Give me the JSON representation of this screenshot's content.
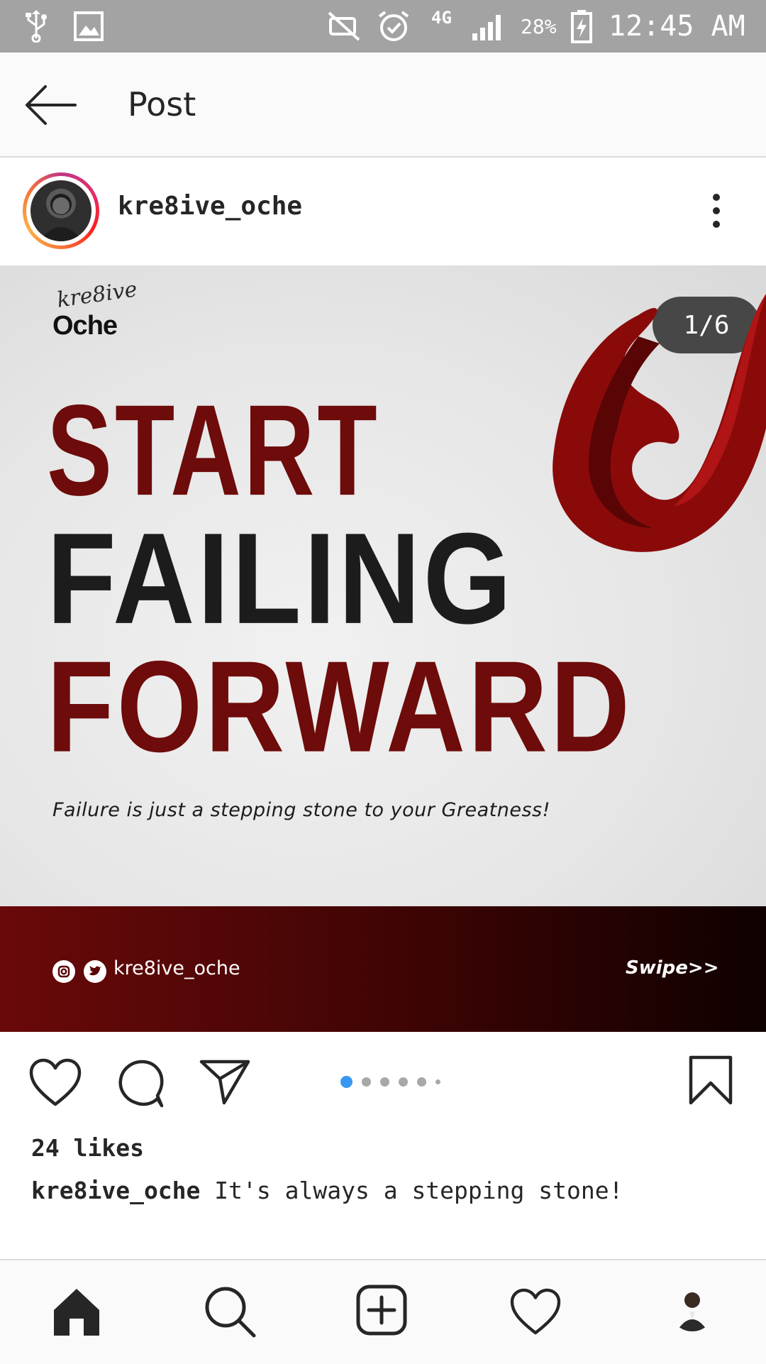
{
  "status_bar": {
    "network": "4G",
    "battery": "28%",
    "time": "12:45 AM",
    "icons": [
      "usb-icon",
      "image-icon",
      "mute-icon",
      "alarm-icon",
      "signal-icon",
      "battery-charging-icon"
    ]
  },
  "app_bar": {
    "title": "Post"
  },
  "post": {
    "username": "kre8ive_oche",
    "image": {
      "counter": "1/6",
      "logo_script": "kre8ive",
      "logo_word": "Oche",
      "headline_1": "START",
      "headline_2": "FAILING",
      "headline_3": "FORWARD",
      "tagline": "Failure is just a stepping stone to your Greatness!",
      "handle": "kre8ive_oche",
      "swipe": "Swipe>>"
    },
    "likes": "24 likes",
    "caption_user": "kre8ive_oche",
    "caption_text": "It's always a stepping stone!",
    "carousel": {
      "count": 6,
      "active_index": 0
    }
  },
  "bottom_nav": [
    "home-icon",
    "search-icon",
    "add-post-icon",
    "activity-heart-icon",
    "profile-avatar"
  ],
  "colors": {
    "status_bar": "#a3a3a3",
    "headline_red": "#6e0b0b",
    "headline_black": "#1c1c1c",
    "carousel_active": "#3897f0",
    "carousel_inactive": "#a8a8a8"
  }
}
